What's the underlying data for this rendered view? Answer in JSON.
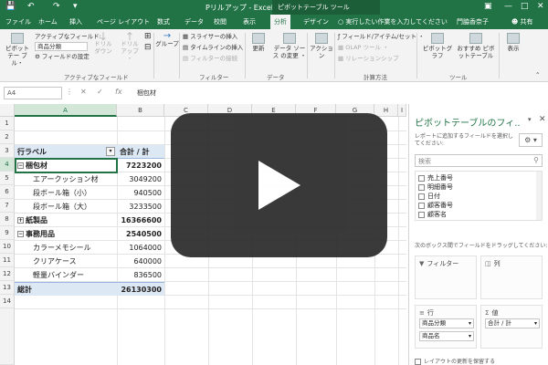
{
  "titlebar": {
    "title": "Pリルアップ - Excel",
    "context_tab": "ピボットテーブル ツール",
    "save_icon": "save-icon",
    "undo_icon": "undo-icon",
    "redo_icon": "redo-icon"
  },
  "tabs": [
    "ファイル",
    "ホーム",
    "挿入",
    "ページ レイアウト",
    "数式",
    "データ",
    "校閲",
    "表示",
    "分析",
    "デザイン"
  ],
  "active_tab": "分析",
  "tellme": "実行したい作業を入力してください",
  "user": "門脇香奈子",
  "share": "共有",
  "ribbon": {
    "pivot_btn": "ピボットテー ブル・",
    "active_field_label": "アクティブなフィールド:",
    "active_field_value": "商品分類",
    "field_settings": "フィールドの設定",
    "drill_down": "ドリル ダウン",
    "drill_up": "ドリル アップ ・",
    "group": "グループ",
    "group_active_field": "アクティブなフィールド",
    "slicer": "スライサーの挿入",
    "timeline": "タイムラインの挿入",
    "filter_conn": "フィルターの接続",
    "group_filter": "フィルター",
    "refresh": "更新",
    "change_source": "データ ソース の変更 ・",
    "group_data": "データ",
    "action": "アクション",
    "fields_items": "フィールド/アイテム/セット ・",
    "olap": "OLAP ツール ・",
    "relations": "リレーションシップ",
    "group_calc": "計算方法",
    "pivot_graph": "ピボットグラフ",
    "recommended": "おすすめ ピボットテーブル",
    "group_tools": "ツール",
    "show": "表示"
  },
  "formula_bar": {
    "name_box": "A4",
    "value": "梱包材"
  },
  "grid": {
    "columns": [
      "A",
      "B",
      "C",
      "D",
      "E",
      "F",
      "G",
      "H",
      "I"
    ],
    "rows": [
      "1",
      "2",
      "3",
      "4",
      "5",
      "6",
      "7",
      "8",
      "9",
      "10",
      "11",
      "12",
      "13",
      "14"
    ],
    "selected_column": "A",
    "selected_row": "4",
    "cells": {
      "r3": {
        "label": "行ラベル",
        "value": "合計 / 計"
      },
      "r4": {
        "label": "梱包材",
        "value": "7223200"
      },
      "r5": {
        "label": "エアークッション材",
        "value": "3049200"
      },
      "r6": {
        "label": "段ボール箱（小）",
        "value": "940500"
      },
      "r7": {
        "label": "段ボール箱（大）",
        "value": "3233500"
      },
      "r8": {
        "label": "紙製品",
        "value": "16366600"
      },
      "r9": {
        "label": "事務用品",
        "value": "2540500"
      },
      "r10": {
        "label": "カラーメモシール",
        "value": "1064000"
      },
      "r11": {
        "label": "クリアケース",
        "value": "640000"
      },
      "r12": {
        "label": "軽量バインダー",
        "value": "836500"
      },
      "r13": {
        "label": "総計",
        "value": "26130300"
      }
    }
  },
  "pane": {
    "title": "ピボットテーブルのフィ...",
    "subtitle": "レポートに追加するフィールドを選択してください:",
    "search_placeholder": "検索",
    "fields": [
      "売上番号",
      "明細番号",
      "日付",
      "顧客番号",
      "顧客名"
    ],
    "drag_hint": "次のボックス間でフィールドをドラッグしてください:",
    "zone_filter": "フィルター",
    "zone_columns": "列",
    "zone_rows": "行",
    "zone_values": "値",
    "row_items": [
      "商品分類",
      "商品名"
    ],
    "value_items": [
      "合計 / 計"
    ],
    "footer": "レイアウトの更新を保留する"
  },
  "overlay": {
    "icon": "play-icon"
  }
}
